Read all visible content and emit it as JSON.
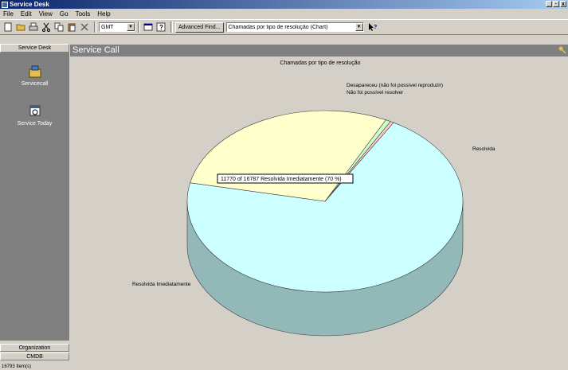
{
  "window": {
    "title": "Service Desk",
    "controls": [
      "_",
      "·",
      "x"
    ]
  },
  "menu": [
    "File",
    "Edit",
    "View",
    "Go",
    "Tools",
    "Help"
  ],
  "toolbar": {
    "timezone": "GMT",
    "advanced_find": "Advanced Find...",
    "view_select": "Chamadas por tipo de resolução (Chart)"
  },
  "sidebar": {
    "header": "Service Desk",
    "items": [
      {
        "label": "Servicecall",
        "icon": "service-call-icon"
      },
      {
        "label": "Service Today",
        "icon": "service-today-icon"
      }
    ],
    "bottom": [
      "Organization",
      "CMDB"
    ]
  },
  "content_header": {
    "title": "Service Call"
  },
  "chart_data": {
    "type": "pie",
    "title": "Chamadas por tipo de resolução",
    "slices": [
      {
        "label": "Resolvida Imediatamente",
        "value": 70,
        "color": "#ccffff"
      },
      {
        "label": "Resolvida",
        "value": 29,
        "color": "#ffffcc"
      },
      {
        "label": "Não foi possível resolver",
        "value": 0.6,
        "color": "#ccffcc"
      },
      {
        "label": "Desapareceu (não foi possível reproduzir)",
        "value": 0.4,
        "color": "#ffcccc"
      }
    ],
    "tooltip": "11770 of 16787 Resolvida Imediatamente (70 %)"
  },
  "status": {
    "text": "16793 Item(s)"
  },
  "colors": {
    "title_start": "#0a246a",
    "title_end": "#a6caf0",
    "sidebar": "#808080",
    "panel": "#d4d0c8"
  }
}
